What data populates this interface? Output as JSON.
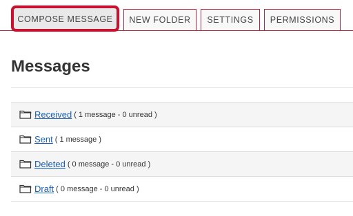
{
  "toolbar": {
    "tabs": [
      {
        "label": "COMPOSE MESSAGE",
        "active": true
      },
      {
        "label": "NEW FOLDER",
        "active": false
      },
      {
        "label": "SETTINGS",
        "active": false
      },
      {
        "label": "PERMISSIONS",
        "active": false
      }
    ]
  },
  "page": {
    "title": "Messages"
  },
  "folders": [
    {
      "name": "Received",
      "meta": "( 1 message - 0 unread )",
      "icon": "folder-icon"
    },
    {
      "name": "Sent",
      "meta": "( 1 message )",
      "icon": "folder-icon"
    },
    {
      "name": "Deleted",
      "meta": "( 0 message - 0 unread )",
      "icon": "folder-icon"
    },
    {
      "name": "Draft",
      "meta": "( 0 message - 0 unread )",
      "icon": "folder-icon"
    }
  ],
  "colors": {
    "accent": "#c41230",
    "link": "#1a5fb4"
  }
}
